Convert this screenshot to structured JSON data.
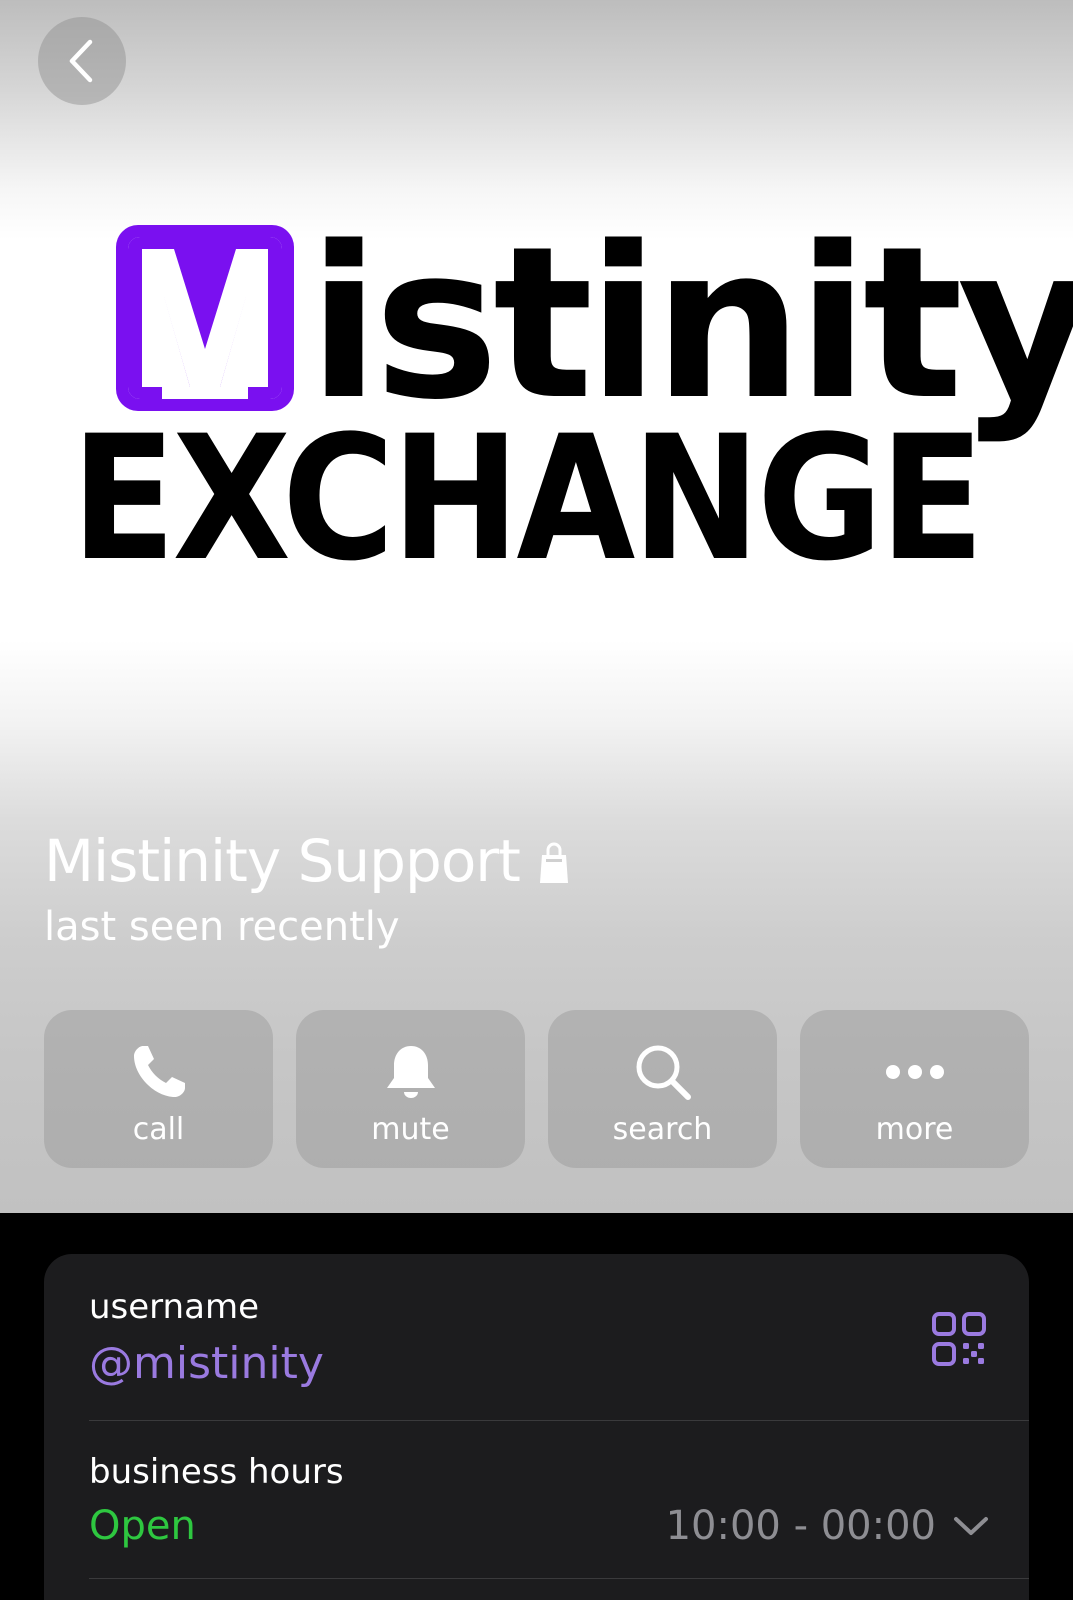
{
  "header": {
    "back_icon": "chevron-left-icon"
  },
  "logo": {
    "brand_letter": "M",
    "brand_word": "istinity",
    "brand_sub": "EXCHANGE",
    "accent_color": "#7a10f0"
  },
  "profile": {
    "name": "Mistinity Support",
    "badge_icon": "shopping-bag-icon",
    "status": "last seen recently"
  },
  "actions": [
    {
      "label": "call",
      "icon": "phone-icon"
    },
    {
      "label": "mute",
      "icon": "bell-icon"
    },
    {
      "label": "search",
      "icon": "search-icon"
    },
    {
      "label": "more",
      "icon": "ellipsis-icon"
    }
  ],
  "info": {
    "username_label": "username",
    "username_value": "@mistinity",
    "username_icon": "qr-code-icon",
    "business_hours_label": "business hours",
    "business_status": "Open",
    "business_hours": "10:00 - 00:00",
    "status_color": "#2ec740",
    "link_color": "#9a7ae0"
  }
}
